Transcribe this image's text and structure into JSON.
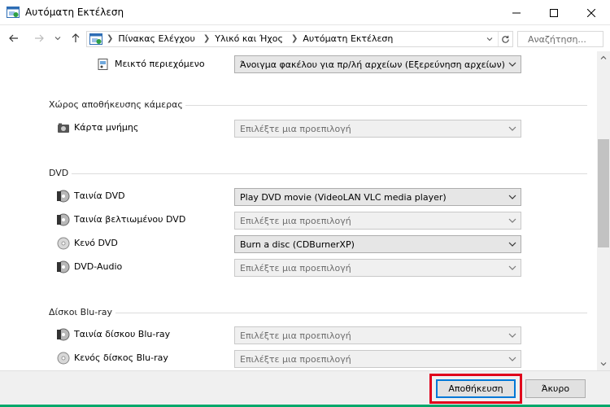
{
  "window": {
    "title": "Αυτόματη Εκτέλεση",
    "controls": {
      "minimize": "minimize-icon",
      "maximize": "maximize-icon",
      "close": "close-icon"
    }
  },
  "addressbar": {
    "breadcrumbs": [
      "Πίνακας Ελέγχου",
      "Υλικό και Ήχος",
      "Αυτόματη Εκτέλεση"
    ],
    "search_placeholder": "Αναζήτηση..."
  },
  "content": {
    "mixed": {
      "label": "Μεικτό περιεχόμενο",
      "value": "Άνοιγμα φακέλου για πρ/λή αρχείων (Εξερεύνηση αρχείων)"
    },
    "sections": [
      {
        "heading": "Χώρος αποθήκευσης κάμερας",
        "items": [
          {
            "label": "Κάρτα μνήμης",
            "value": "Επιλέξτε μια προεπιλογή",
            "placeholder": true,
            "icon": "memory-card-icon"
          }
        ]
      },
      {
        "heading": "DVD",
        "items": [
          {
            "label": "Ταινία DVD",
            "value": "Play DVD movie (VideoLAN VLC media player)",
            "placeholder": false,
            "icon": "dvd-movie-icon"
          },
          {
            "label": "Ταινία βελτιωμένου DVD",
            "value": "Επιλέξτε μια προεπιλογή",
            "placeholder": true,
            "icon": "dvd-movie-icon"
          },
          {
            "label": "Κενό DVD",
            "value": "Burn a disc (CDBurnerXP)",
            "placeholder": false,
            "icon": "blank-disc-icon"
          },
          {
            "label": "DVD-Audio",
            "value": "Επιλέξτε μια προεπιλογή",
            "placeholder": true,
            "icon": "dvd-movie-icon"
          }
        ]
      },
      {
        "heading": "Δίσκοι Blu-ray",
        "items": [
          {
            "label": "Ταινία δίσκου Blu-ray",
            "value": "Επιλέξτε μια προεπιλογή",
            "placeholder": true,
            "icon": "dvd-movie-icon"
          },
          {
            "label": "Κενός δίσκος Blu-ray",
            "value": "Επιλέξτε μια προεπιλογή",
            "placeholder": true,
            "icon": "blank-disc-icon"
          }
        ]
      }
    ]
  },
  "footer": {
    "save_label": "Αποθήκευση",
    "cancel_label": "Άκυρο"
  },
  "colors": {
    "highlight": "#e0001b",
    "accent": "#0078d7"
  }
}
